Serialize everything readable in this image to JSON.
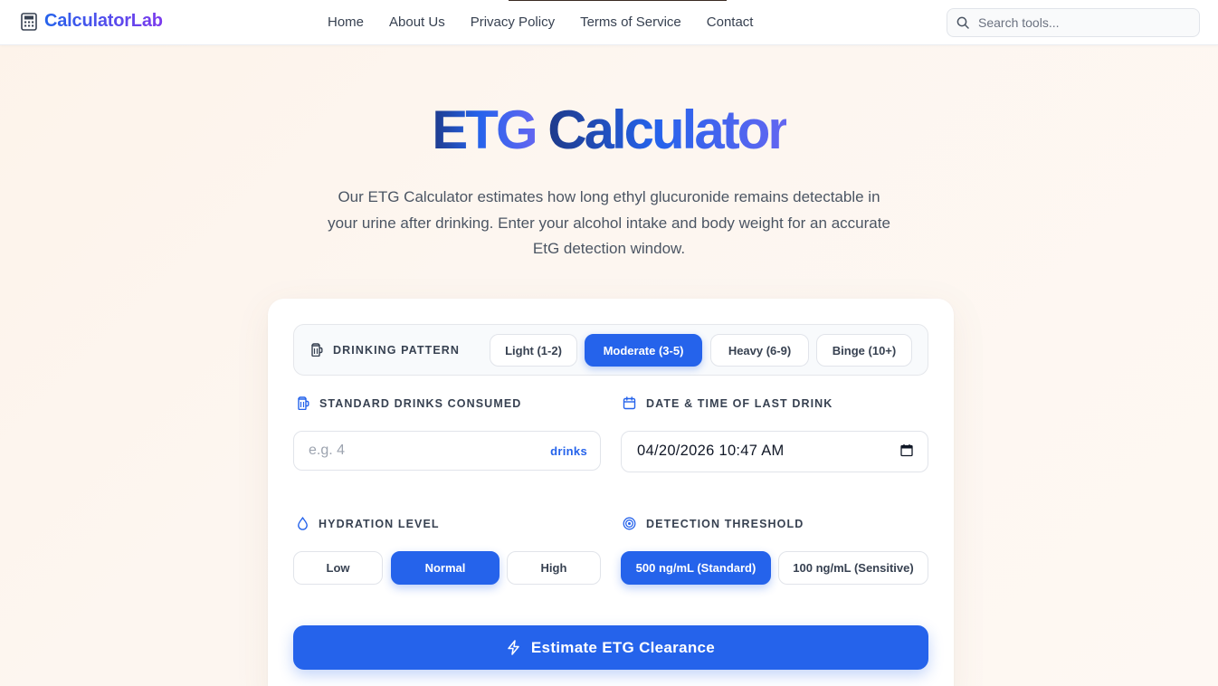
{
  "header": {
    "logo_text": "CalculatorLab",
    "nav": [
      "Home",
      "About Us",
      "Privacy Policy",
      "Terms of Service",
      "Contact"
    ],
    "search_placeholder": "Search tools..."
  },
  "hero": {
    "title_part1": "ETG",
    "title_part2": "Calculator",
    "subtitle": "Our ETG Calculator estimates how long ethyl glucuronide remains detectable in your urine after drinking. Enter your alcohol intake and body weight for an accurate EtG detection window."
  },
  "form": {
    "pattern": {
      "label": "DRINKING PATTERN",
      "options": [
        "Light (1-2)",
        "Moderate (3-5)",
        "Heavy (6-9)",
        "Binge (10+)"
      ],
      "selected": "Moderate (3-5)"
    },
    "drinks": {
      "label": "STANDARD DRINKS CONSUMED",
      "placeholder": "e.g. 4",
      "suffix": "drinks"
    },
    "last_drink": {
      "label": "DATE & TIME OF LAST DRINK",
      "value": "04/20/2026 10:47 AM"
    },
    "hydration": {
      "label": "HYDRATION LEVEL",
      "options": [
        "Low",
        "Normal",
        "High"
      ],
      "selected": "Normal"
    },
    "threshold": {
      "label": "DETECTION THRESHOLD",
      "options": [
        "500 ng/mL (Standard)",
        "100 ng/mL (Sensitive)"
      ],
      "selected": "500 ng/mL (Standard)"
    },
    "submit_label": "Estimate ETG Clearance"
  },
  "colors": {
    "accent": "#2563eb",
    "background": "#fdf5ee"
  }
}
